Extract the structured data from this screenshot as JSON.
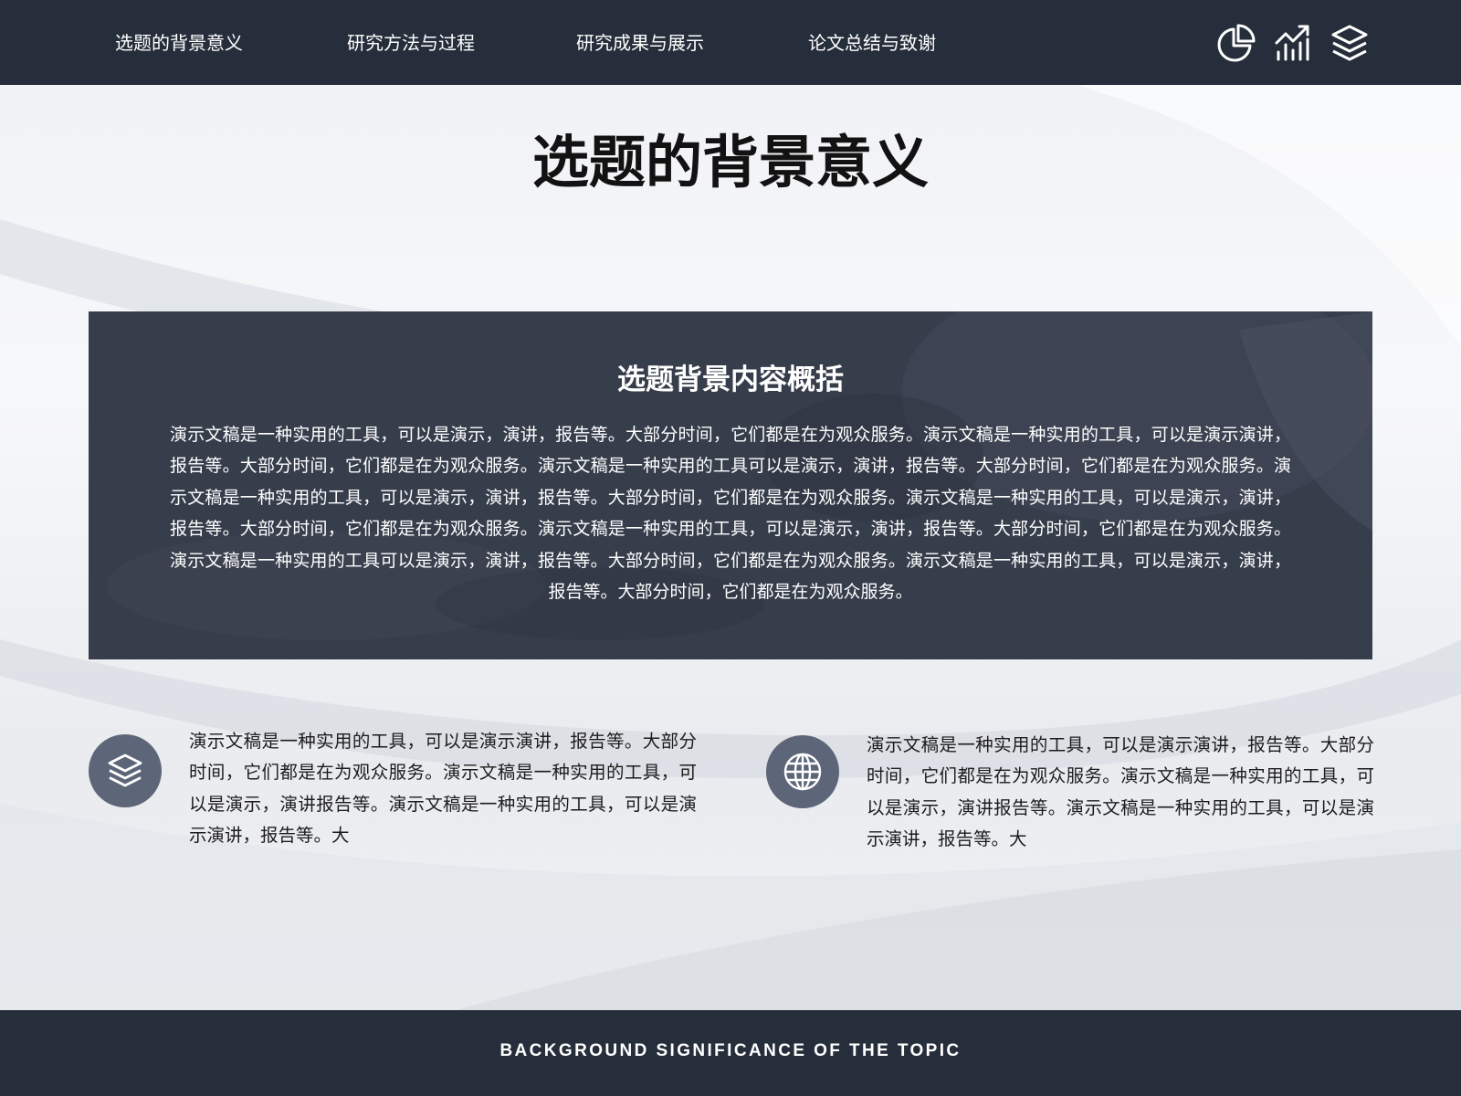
{
  "colors": {
    "nav_background": "#262e3b",
    "panel_background": "#363d4b",
    "icon_circle": "#5d6678",
    "title_text": "#121212",
    "body_text": "#1c1c1c"
  },
  "nav": {
    "items": [
      {
        "label": "选题的背景意义"
      },
      {
        "label": "研究方法与过程"
      },
      {
        "label": "研究成果与展示"
      },
      {
        "label": "论文总结与致谢"
      }
    ],
    "icons": [
      "pie-chart-icon",
      "growth-chart-icon",
      "layers-icon"
    ]
  },
  "page": {
    "title": "选题的背景意义"
  },
  "panel": {
    "title": "选题背景内容概括",
    "text": "演示文稿是一种实用的工具，可以是演示，演讲，报告等。大部分时间，它们都是在为观众服务。演示文稿是一种实用的工具，可以是演示演讲，报告等。大部分时间，它们都是在为观众服务。演示文稿是一种实用的工具可以是演示，演讲，报告等。大部分时间，它们都是在为观众服务。演示文稿是一种实用的工具，可以是演示，演讲，报告等。大部分时间，它们都是在为观众服务。演示文稿是一种实用的工具，可以是演示，演讲，报告等。大部分时间，它们都是在为观众服务。演示文稿是一种实用的工具，可以是演示，演讲，报告等。大部分时间，它们都是在为观众服务。演示文稿是一种实用的工具可以是演示，演讲，报告等。大部分时间，它们都是在为观众服务。演示文稿是一种实用的工具，可以是演示，演讲，报告等。大部分时间，它们都是在为观众服务。"
  },
  "features": [
    {
      "icon": "layers-icon",
      "text": "演示文稿是一种实用的工具，可以是演示演讲，报告等。大部分时间，它们都是在为观众服务。演示文稿是一种实用的工具，可以是演示，演讲报告等。演示文稿是一种实用的工具，可以是演示演讲，报告等。大"
    },
    {
      "icon": "globe-icon",
      "text": "演示文稿是一种实用的工具，可以是演示演讲，报告等。大部分时间，它们都是在为观众服务。演示文稿是一种实用的工具，可以是演示，演讲报告等。演示文稿是一种实用的工具，可以是演示演讲，报告等。大"
    }
  ],
  "footer": {
    "text": "BACKGROUND SIGNIFICANCE OF THE TOPIC"
  }
}
